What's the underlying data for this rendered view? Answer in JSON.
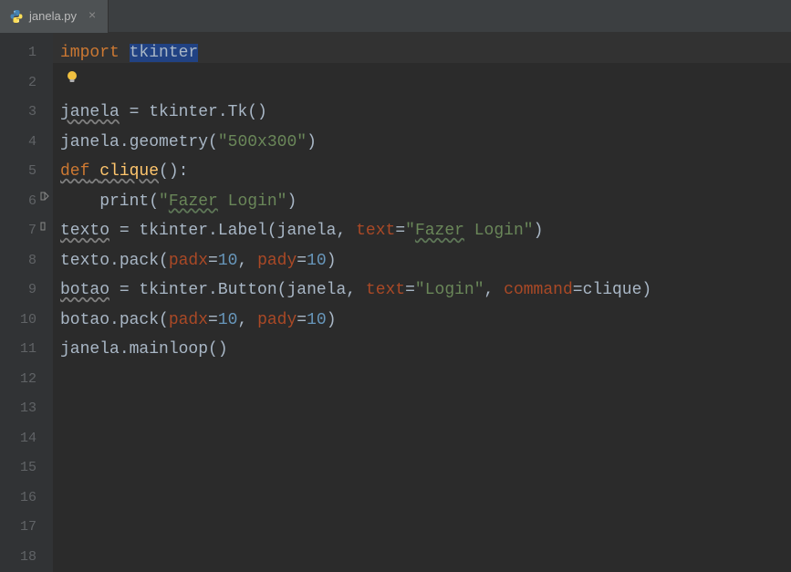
{
  "tab": {
    "filename": "janela.py",
    "close_label": "×"
  },
  "code": {
    "lines": [
      {
        "n": "1"
      },
      {
        "n": "2"
      },
      {
        "n": "3"
      },
      {
        "n": "4"
      },
      {
        "n": "5"
      },
      {
        "n": "6"
      },
      {
        "n": "7"
      },
      {
        "n": "8"
      },
      {
        "n": "9"
      },
      {
        "n": "10"
      },
      {
        "n": "11"
      },
      {
        "n": "12"
      },
      {
        "n": "13"
      },
      {
        "n": "14"
      },
      {
        "n": "15"
      },
      {
        "n": "16"
      },
      {
        "n": "17"
      },
      {
        "n": "18"
      }
    ],
    "tokens": {
      "t_import": "import",
      "t_tkinter": "tkinter",
      "t_janela": "janela",
      "t_eq": " = ",
      "t_tk": ".Tk()",
      "t_geom": ".geometry(",
      "t_500x300": "\"500x300\"",
      "t_close": ")",
      "t_def": "def",
      "t_sp": " ",
      "t_clique": "clique",
      "t_parencolon": "():",
      "t_print": "print",
      "t_open": "(",
      "t_fazerlogin_str": "\"Fazer Login\"",
      "t_fazer": "Fazer",
      "t_login_sp": " Login",
      "t_quote": "\"",
      "t_texto": "texto",
      "t_label": ".Label(",
      "t_comma": ", ",
      "t_text": "text",
      "t_eqsign": "=",
      "t_pack": ".pack(",
      "t_padx": "padx",
      "t_pady": "pady",
      "t_10": "10",
      "t_botao": "botao",
      "t_button": ".Button(",
      "t_login_str": "\"Login\"",
      "t_command": "command",
      "t_mainloop": ".mainloop()"
    }
  }
}
